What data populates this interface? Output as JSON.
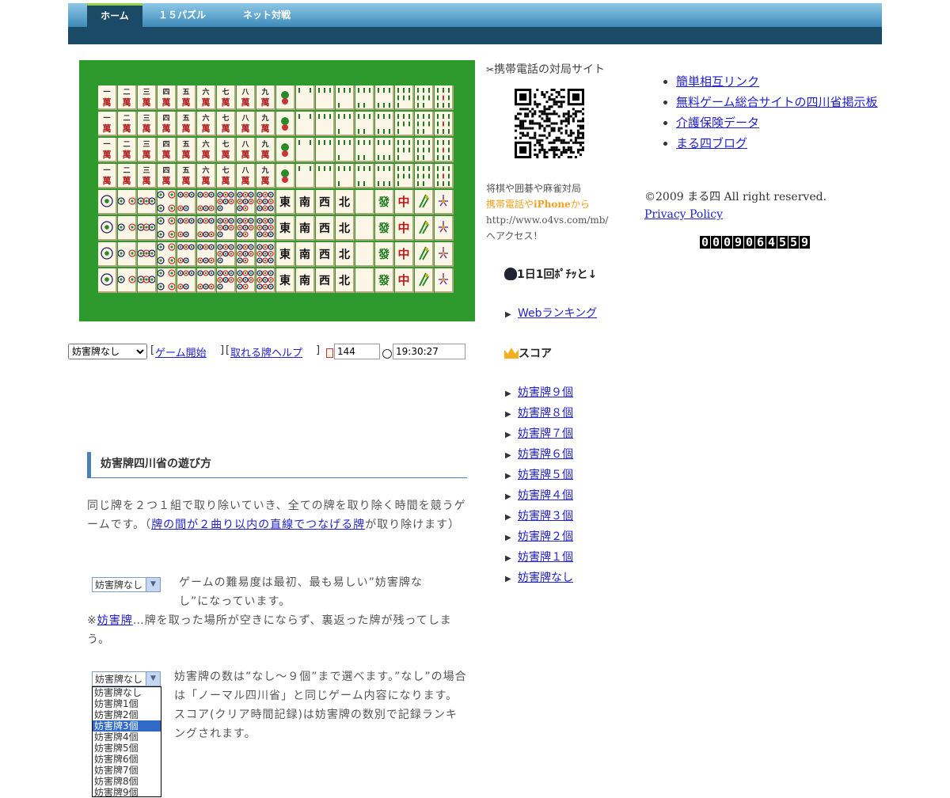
{
  "nav": {
    "items": [
      {
        "label": "ホーム",
        "active": true
      },
      {
        "label": "１５パズル",
        "active": false
      },
      {
        "label": "ネット対戦",
        "active": false
      }
    ]
  },
  "board": {
    "background_color": "#2e9a2e",
    "rows": [
      [
        "一萬",
        "二萬",
        "三萬",
        "四萬",
        "五萬",
        "六萬",
        "七萬",
        "八萬",
        "九萬",
        "一索",
        "二索",
        "三索",
        "四索",
        "五索",
        "六索",
        "七索",
        "八索",
        "九索"
      ],
      [
        "一萬",
        "二萬",
        "三萬",
        "四萬",
        "五萬",
        "六萬",
        "七萬",
        "八萬",
        "九萬",
        "一索",
        "二索",
        "三索",
        "四索",
        "五索",
        "六索",
        "七索",
        "八索",
        "九索"
      ],
      [
        "一萬",
        "二萬",
        "三萬",
        "四萬",
        "五萬",
        "六萬",
        "七萬",
        "八萬",
        "九萬",
        "一索",
        "二索",
        "三索",
        "四索",
        "五索",
        "六索",
        "七索",
        "八索",
        "九索"
      ],
      [
        "一萬",
        "二萬",
        "三萬",
        "四萬",
        "五萬",
        "六萬",
        "七萬",
        "八萬",
        "九萬",
        "一索",
        "二索",
        "三索",
        "四索",
        "五索",
        "六索",
        "七索",
        "八索",
        "九索"
      ],
      [
        "一筒",
        "二筒",
        "三筒",
        "四筒",
        "五筒",
        "六筒",
        "七筒",
        "八筒",
        "九筒",
        "東",
        "南",
        "西",
        "北",
        "白",
        "發",
        "中",
        "竹",
        "菊"
      ],
      [
        "一筒",
        "二筒",
        "三筒",
        "四筒",
        "五筒",
        "六筒",
        "七筒",
        "八筒",
        "九筒",
        "東",
        "南",
        "西",
        "北",
        "白",
        "發",
        "中",
        "竹",
        "菊"
      ],
      [
        "一筒",
        "二筒",
        "三筒",
        "四筒",
        "五筒",
        "六筒",
        "七筒",
        "八筒",
        "九筒",
        "東",
        "南",
        "西",
        "北",
        "白",
        "發",
        "中",
        "竹",
        "菊"
      ],
      [
        "一筒",
        "二筒",
        "三筒",
        "四筒",
        "五筒",
        "六筒",
        "七筒",
        "八筒",
        "九筒",
        "東",
        "南",
        "西",
        "北",
        "白",
        "發",
        "中",
        "竹",
        "菊"
      ]
    ]
  },
  "controls": {
    "select_value": "妨害牌なし",
    "start_link": "ゲーム開始",
    "help_link": "取れる牌ヘルプ",
    "tiles_left": "144",
    "time": "19:30:27"
  },
  "article": {
    "title": "妨害牌四川省の遊び方",
    "p1_a": "同じ牌を２つ１組で取り除いていき、全ての牌を取り除く時間を競うゲームです。（",
    "p1_link": "牌の間が２曲り以内の直線でつなげる牌",
    "p1_b": "が取り除けます）",
    "select1": "妨害牌なし",
    "p2": "ゲームの難易度は最初、最も易しい”妨害牌なし”になっています。",
    "p3_a": "※",
    "p3_link": "妨害牌",
    "p3_b": "…牌を取った場所が空きにならず、裏返った牌が残ってしまう。",
    "select2": "妨害牌なし",
    "dropdown_options": [
      "妨害牌なし",
      "妨害牌1個",
      "妨害牌2個",
      "妨害牌3個",
      "妨害牌4個",
      "妨害牌5個",
      "妨害牌6個",
      "妨害牌7個",
      "妨害牌8個",
      "妨害牌9個"
    ],
    "dropdown_selected": "妨害牌3個",
    "p4": "妨害牌の数は”なし～９個”まで選べます。”なし”の場合は「ノーマル四川省」と同じゲーム内容になります。スコア(クリア時間記録)は妨害牌の数別で記録ランキングされます。"
  },
  "mobile": {
    "title": "携帯電話の対局サイト",
    "line1": "将棋や囲碁や麻雀対局",
    "line2_orange": "携帯電話や",
    "line2_bold": "iPhone",
    "line2_end": "から",
    "url": "http://www.o4vs.com/mb/",
    "line4": "へアクセス！"
  },
  "ranking": {
    "heading": "1日1回ﾎﾟﾁｯと↓",
    "link": "Webランキング"
  },
  "score": {
    "heading": "スコア",
    "links": [
      "妨害牌９個",
      "妨害牌８個",
      "妨害牌７個",
      "妨害牌６個",
      "妨害牌５個",
      "妨害牌４個",
      "妨害牌３個",
      "妨害牌２個",
      "妨害牌１個",
      "妨害牌なし"
    ]
  },
  "right": {
    "links": [
      "簡単相互リンク",
      "無料ゲーム総合サイトの四川省掲示板",
      "介護保険データ",
      "まる四ブログ"
    ],
    "copyright": "©2009 まる四 All right reserved.",
    "privacy": "Privacy Policy",
    "counter": "0009064559"
  },
  "colors": {
    "nav_dark": "#1a4a66",
    "link": "#2222cc",
    "board_green": "#2e9a2e",
    "accent_blue": "#4a7fb8"
  }
}
